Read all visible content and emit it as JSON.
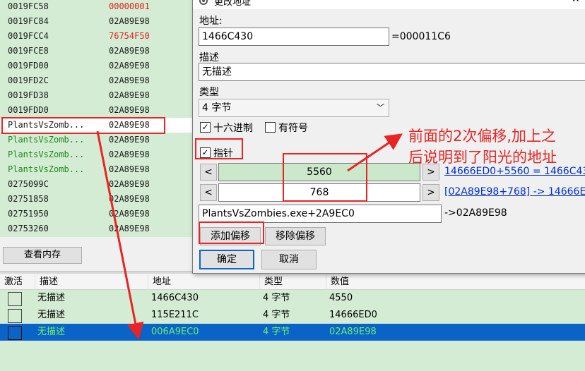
{
  "memory_list": {
    "rows": [
      {
        "addr": "0019FC58",
        "value": "00000001",
        "addr_color": "#1a1a1a",
        "value_color": "#e02020"
      },
      {
        "addr": "0019FC84",
        "value": "02A89E98",
        "addr_color": "#1a1a1a",
        "value_color": "#1a1a1a"
      },
      {
        "addr": "0019FCC4",
        "value": "76754F50",
        "addr_color": "#1a1a1a",
        "value_color": "#e02020"
      },
      {
        "addr": "0019FCE8",
        "value": "02A89E98",
        "addr_color": "#1a1a1a",
        "value_color": "#1a1a1a"
      },
      {
        "addr": "0019FD00",
        "value": "02A89E98",
        "addr_color": "#1a1a1a",
        "value_color": "#1a1a1a"
      },
      {
        "addr": "0019FD2C",
        "value": "02A89E98",
        "addr_color": "#1a1a1a",
        "value_color": "#1a1a1a"
      },
      {
        "addr": "0019FD38",
        "value": "02A89E98",
        "addr_color": "#1a1a1a",
        "value_color": "#1a1a1a"
      },
      {
        "addr": "0019FDD0",
        "value": "02A89E98",
        "addr_color": "#1a1a1a",
        "value_color": "#1a1a1a"
      },
      {
        "addr": "PlantsVsZomb...",
        "value": "02A89E98",
        "addr_color": "#1a1a1a",
        "value_color": "#1a1a1a"
      },
      {
        "addr": "PlantsVsZomb...",
        "value": "02A89E98",
        "addr_color": "#1a8a1a",
        "value_color": "#1a1a1a"
      },
      {
        "addr": "PlantsVsZomb...",
        "value": "02A89E98",
        "addr_color": "#1a8a1a",
        "value_color": "#1a1a1a"
      },
      {
        "addr": "PlantsVsZomb...",
        "value": "02A89E98",
        "addr_color": "#1a8a1a",
        "value_color": "#1a1a1a"
      },
      {
        "addr": "0275099C",
        "value": "02A89E98",
        "addr_color": "#1a1a1a",
        "value_color": "#1a1a1a"
      },
      {
        "addr": "02751858",
        "value": "02A89E98",
        "addr_color": "#1a1a1a",
        "value_color": "#1a1a1a"
      },
      {
        "addr": "02751950",
        "value": "02A89E98",
        "addr_color": "#1a1a1a",
        "value_color": "#1a1a1a"
      },
      {
        "addr": "02753260",
        "value": "02A89E98",
        "addr_color": "#1a1a1a",
        "value_color": "#1a1a1a"
      }
    ],
    "view_memory_button": "查看内存"
  },
  "cheat_table": {
    "headers": [
      "激活",
      "描述",
      "地址",
      "类型",
      "数值"
    ],
    "rows": [
      {
        "description": "无描述",
        "address": "1466C430",
        "type": "4 字节",
        "value": "4550"
      },
      {
        "description": "无描述",
        "address": "115E211C",
        "type": "4 字节",
        "value": "14666ED0"
      },
      {
        "description": "无描述",
        "address": "006A9EC0",
        "type": "4 字节",
        "value": "02A89E98"
      }
    ]
  },
  "dialog": {
    "title": "更改地址",
    "address_label": "地址:",
    "address_value": "1466C430",
    "address_result": "=000011C6",
    "description_label": "描述",
    "description_value": "无描述",
    "type_label": "类型",
    "type_value": "4 字节",
    "hex_label": "十六进制",
    "signed_label": "有符号",
    "pointer_label": "指针",
    "offsets": [
      {
        "value": "5560",
        "link": "14666ED0+5560 = 1466C43"
      },
      {
        "value": "768",
        "link": "[02A89E98+768] -> 14666E"
      }
    ],
    "base_value": "PlantsVsZombies.exe+2A9EC0",
    "base_result": "->02A89E98",
    "add_offset_button": "添加偏移",
    "remove_offset_button": "移除偏移",
    "ok_button": "确定",
    "cancel_button": "取消"
  },
  "annotation": {
    "line1": "前面的2次偏移,加上之",
    "line2": "后说明到了阳光的地址"
  }
}
